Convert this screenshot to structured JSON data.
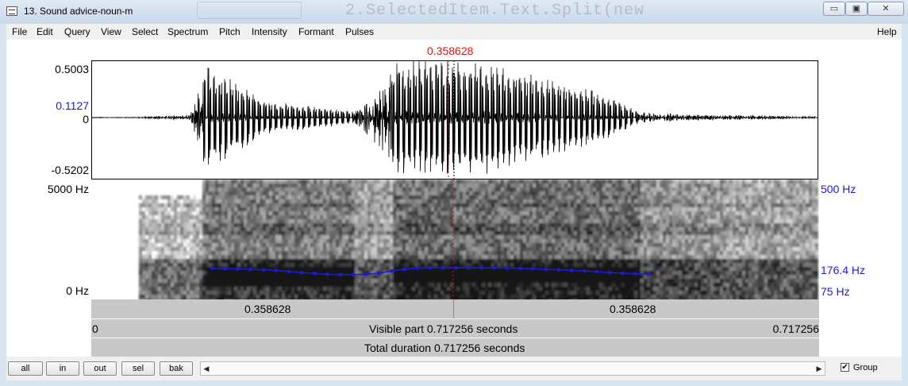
{
  "window": {
    "title": "13. Sound advice-noun-m",
    "background_ghost_text": "2.SelectedItem.Text.Split(new",
    "buttons": {
      "minimize": "▭",
      "maximize": "▣",
      "close": "✕"
    }
  },
  "menu": {
    "items": [
      "File",
      "Edit",
      "Query",
      "View",
      "Select",
      "Spectrum",
      "Pitch",
      "Intensity",
      "Formant",
      "Pulses"
    ],
    "help": "Help"
  },
  "cursor": {
    "time_label": "0.358628",
    "time_s": 0.358628
  },
  "waveform": {
    "y_max": "0.5003",
    "y_cursor": "0.1127",
    "y_zero": "0",
    "y_min": "-0.5202"
  },
  "spectrogram": {
    "freq_top": "5000 Hz",
    "freq_bottom": "0 Hz",
    "pitch_top": "500 Hz",
    "pitch_cursor": "176.4 Hz",
    "pitch_bottom": "75 Hz",
    "pitch_track_hz": [
      185,
      184,
      183,
      182,
      180,
      178,
      174,
      170,
      167,
      164,
      163,
      163,
      164,
      168,
      176,
      182,
      186,
      187,
      187,
      187,
      187,
      187,
      187,
      186,
      185,
      184,
      182,
      180,
      178,
      176,
      173,
      170,
      168,
      166,
      164
    ]
  },
  "time_bars": {
    "left_segment": "0.358628",
    "right_segment": "0.358628",
    "visible_start": "0",
    "visible_label": "Visible part 0.717256 seconds",
    "visible_end": "0.717256",
    "total_label": "Total duration 0.717256 seconds"
  },
  "bottom": {
    "buttons": {
      "all": "all",
      "in": "in",
      "out": "out",
      "sel": "sel",
      "bak": "bak"
    },
    "group_checked": "✔",
    "group_label": "Group",
    "scroll_left": "◀",
    "scroll_right": "▶"
  }
}
